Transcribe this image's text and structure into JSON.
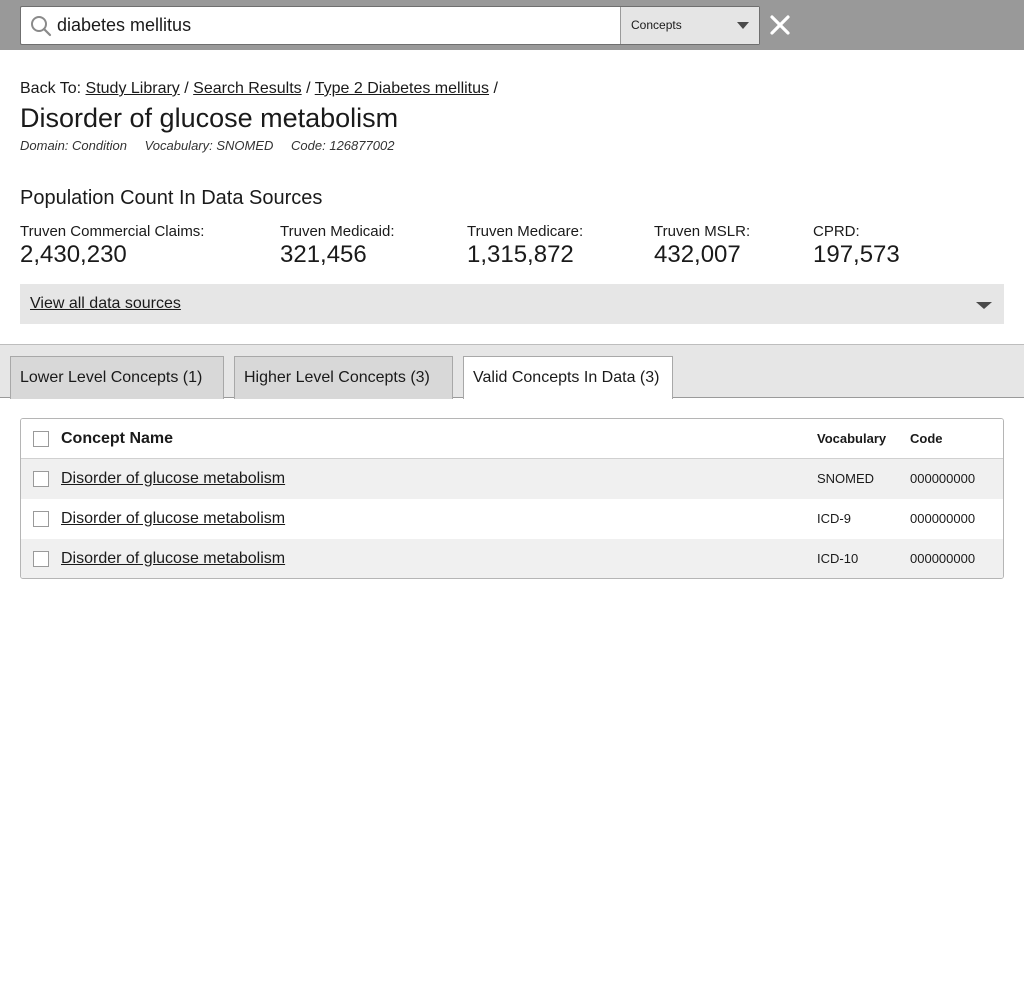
{
  "search": {
    "query": "diabetes mellitus",
    "scope": "Concepts"
  },
  "breadcrumb": {
    "prefix": "Back To:",
    "items": [
      "Study Library",
      "Search Results",
      "Type 2 Diabetes mellitus"
    ],
    "separator": "/"
  },
  "concept": {
    "title": "Disorder of glucose metabolism",
    "domain": "Domain: Condition",
    "vocabulary": "Vocabulary: SNOMED",
    "code": "Code: 126877002"
  },
  "population": {
    "heading": "Population Count In Data Sources",
    "sources": [
      {
        "label": "Truven Commercial Claims:",
        "value": "2,430,230"
      },
      {
        "label": "Truven Medicaid:",
        "value": "321,456"
      },
      {
        "label": "Truven Medicare:",
        "value": "1,315,872"
      },
      {
        "label": "Truven MSLR:",
        "value": "432,007"
      },
      {
        "label": "CPRD:",
        "value": "197,573"
      }
    ],
    "view_all_label": "View all data sources"
  },
  "tabs": [
    {
      "label": "Lower Level Concepts (1)",
      "active": false
    },
    {
      "label": "Higher Level Concepts (3)",
      "active": false
    },
    {
      "label": "Valid Concepts In Data (3)",
      "active": true
    }
  ],
  "table": {
    "columns": {
      "name": "Concept Name",
      "vocabulary": "Vocabulary",
      "code": "Code"
    },
    "rows": [
      {
        "name": "Disorder of glucose metabolism",
        "vocabulary": "SNOMED",
        "code": "000000000"
      },
      {
        "name": "Disorder of glucose metabolism",
        "vocabulary": "ICD-9",
        "code": "000000000"
      },
      {
        "name": "Disorder of glucose metabolism",
        "vocabulary": "ICD-10",
        "code": "000000000"
      }
    ]
  },
  "icons": {
    "search": "search-icon",
    "close": "close-icon",
    "dropdown": "chevron-down-icon"
  },
  "colors": {
    "topbar": "#999999",
    "panel": "#e6e6e6",
    "row_shade": "#f0f0f0"
  }
}
